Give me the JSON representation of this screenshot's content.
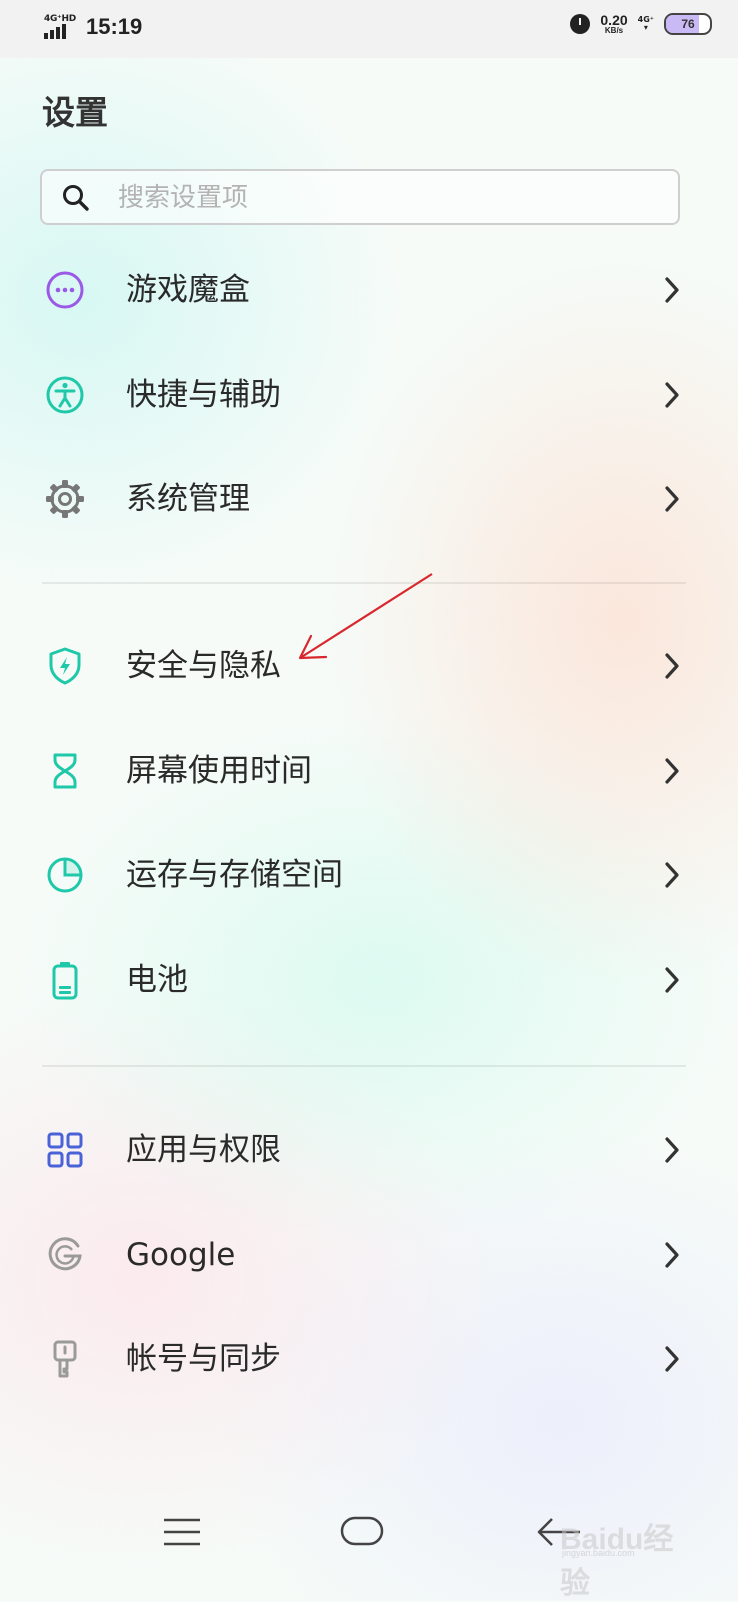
{
  "status_bar": {
    "network_type": "4G⁺HD",
    "time": "15:19",
    "net_speed": "0.20",
    "net_speed_unit": "KB/s",
    "mobile_data": "4G⁺",
    "battery_level": "76",
    "battery_fraction": 0.76
  },
  "page": {
    "title": "设置",
    "search_placeholder": "搜索设置项"
  },
  "settings_groups": [
    [
      {
        "label": "游戏魔盒",
        "icon": "game-box-icon",
        "color": "#9b59e8"
      },
      {
        "label": "快捷与辅助",
        "icon": "accessibility-icon",
        "color": "#1fc8a8"
      },
      {
        "label": "系统管理",
        "icon": "gear-icon",
        "color": "#777777"
      }
    ],
    [
      {
        "label": "安全与隐私",
        "icon": "shield-icon",
        "color": "#1fc8a8"
      },
      {
        "label": "屏幕使用时间",
        "icon": "hourglass-icon",
        "color": "#1fc8a8"
      },
      {
        "label": "运存与存储空间",
        "icon": "pie-chart-icon",
        "color": "#1fc8a8"
      },
      {
        "label": "电池",
        "icon": "battery-icon",
        "color": "#1fc8a8"
      }
    ],
    [
      {
        "label": "应用与权限",
        "icon": "apps-grid-icon",
        "color": "#4a62d8"
      },
      {
        "label": "Google",
        "icon": "google-icon",
        "color": "#9a9a9a"
      },
      {
        "label": "帐号与同步",
        "icon": "key-icon",
        "color": "#9a9a9a"
      }
    ]
  ],
  "navigation_bar": {
    "menu": "menu-icon",
    "home": "home-icon",
    "back": "back-icon"
  },
  "watermark": {
    "text": "Baidu经验",
    "sub": "jingyan.baidu.com"
  },
  "annotation_arrow_color": "#d9272e"
}
